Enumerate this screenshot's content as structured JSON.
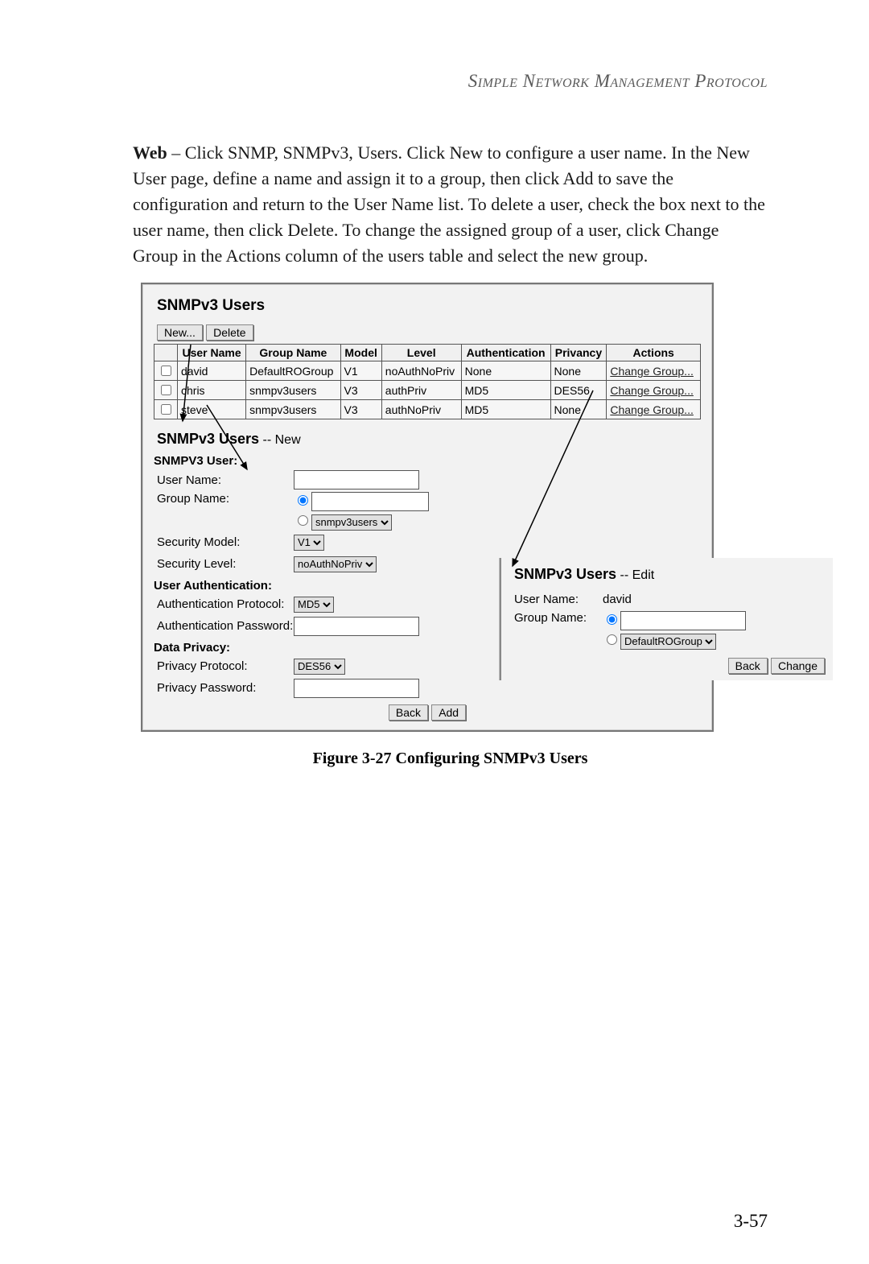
{
  "header": "Simple Network Management Protocol",
  "body_lead": "Web",
  "body_text": " – Click SNMP, SNMPv3, Users. Click New to configure a user name. In the New User page, define a name and assign it to a group, then click Add to save the configuration and return to the User Name list. To delete a user, check the box next to the user name, then click Delete. To change the assigned group of a user, click Change Group in the Actions column of the users table and select the new group.",
  "users_panel": {
    "title": "SNMPv3 Users",
    "buttons": {
      "new": "New...",
      "delete": "Delete"
    },
    "columns": [
      "",
      "User Name",
      "Group Name",
      "Model",
      "Level",
      "Authentication",
      "Privancy",
      "Actions"
    ],
    "rows": [
      {
        "user": "david",
        "group": "DefaultROGroup",
        "model": "V1",
        "level": "noAuthNoPriv",
        "auth": "None",
        "priv": "None",
        "action": "Change Group..."
      },
      {
        "user": "chris",
        "group": "snmpv3users",
        "model": "V3",
        "level": "authPriv",
        "auth": "MD5",
        "priv": "DES56",
        "action": "Change Group..."
      },
      {
        "user": "steve",
        "group": "snmpv3users",
        "model": "V3",
        "level": "authNoPriv",
        "auth": "MD5",
        "priv": "None",
        "action": "Change Group..."
      }
    ]
  },
  "new_panel": {
    "title": "SNMPv3 Users",
    "mode": " -- New",
    "section_user": "SNMPV3 User:",
    "labels": {
      "user_name": "User Name:",
      "group_name": "Group Name:",
      "sec_model": "Security Model:",
      "sec_level": "Security Level:"
    },
    "group_select": "snmpv3users",
    "sec_model_val": "V1",
    "sec_level_val": "noAuthNoPriv",
    "section_auth": "User Authentication:",
    "auth_proto_label": "Authentication Protocol:",
    "auth_proto_val": "MD5",
    "auth_pwd_label": "Authentication Password:",
    "section_priv": "Data Privacy:",
    "priv_proto_label": "Privacy Protocol:",
    "priv_proto_val": "DES56",
    "priv_pwd_label": "Privacy Password:",
    "back_btn": "Back",
    "add_btn": "Add"
  },
  "edit_panel": {
    "title": "SNMPv3 Users",
    "mode": " -- Edit",
    "user_label": "User Name:",
    "user_val": "david",
    "group_label": "Group Name:",
    "group_select": "DefaultROGroup",
    "back_btn": "Back",
    "change_btn": "Change"
  },
  "caption": "Figure 3-27   Configuring SNMPv3 Users",
  "page_number": "3-57"
}
